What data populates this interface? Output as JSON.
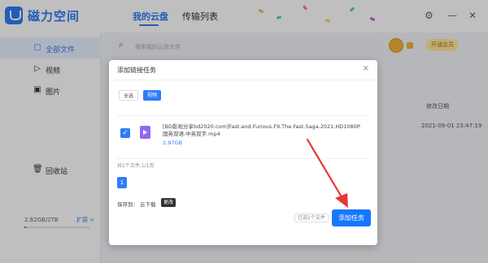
{
  "app": {
    "title": "磁力空间"
  },
  "tabs": [
    {
      "label": "我的云盘",
      "active": true
    },
    {
      "label": "传输列表",
      "active": false
    }
  ],
  "window_controls": {
    "settings": "⚙",
    "minimize": "—",
    "close": "✕"
  },
  "sidebar": {
    "items": [
      {
        "label": "全部文件",
        "icon": "file-icon",
        "glyph": "▢",
        "active": true
      },
      {
        "label": "视频",
        "icon": "video-icon",
        "glyph": "▷",
        "active": false
      },
      {
        "label": "图片",
        "icon": "image-icon",
        "glyph": "▣",
        "active": false
      },
      {
        "label": "回收站",
        "icon": "trash-icon",
        "glyph": "🗑",
        "active": false
      }
    ],
    "storage": {
      "used": "2.62GB/2TB",
      "fraction": 0.0013,
      "expand_label": "扩容 >"
    }
  },
  "header": {
    "search_placeholder": "搜索我的云盘文件",
    "member_label": "开通会员"
  },
  "file_list": {
    "column_modified": "修改日期",
    "rows": [
      {
        "modified": "2021-09-01 23:47:19"
      }
    ]
  },
  "modal": {
    "title": "添加链接任务",
    "close": "×",
    "filters": [
      {
        "label": "全选"
      },
      {
        "label": "视频"
      }
    ],
    "files": [
      {
        "checked": true,
        "name": "[BD影视分享bd2020.com]Fast.and.Furious.F9.The.Fast.Saga.2021.HD1080P.国英双语.中英双字.mp4",
        "size": "2.97GB"
      }
    ],
    "count_text": "共1个文件,1/1页",
    "page": "1",
    "save_label": "保存到：",
    "save_location": "云下载",
    "change_label": "更改",
    "selected_text": "已选1个文件",
    "submit_label": "添加任务"
  },
  "colors": {
    "accent": "#1677ff",
    "annotation_arrow": "#e53935"
  }
}
